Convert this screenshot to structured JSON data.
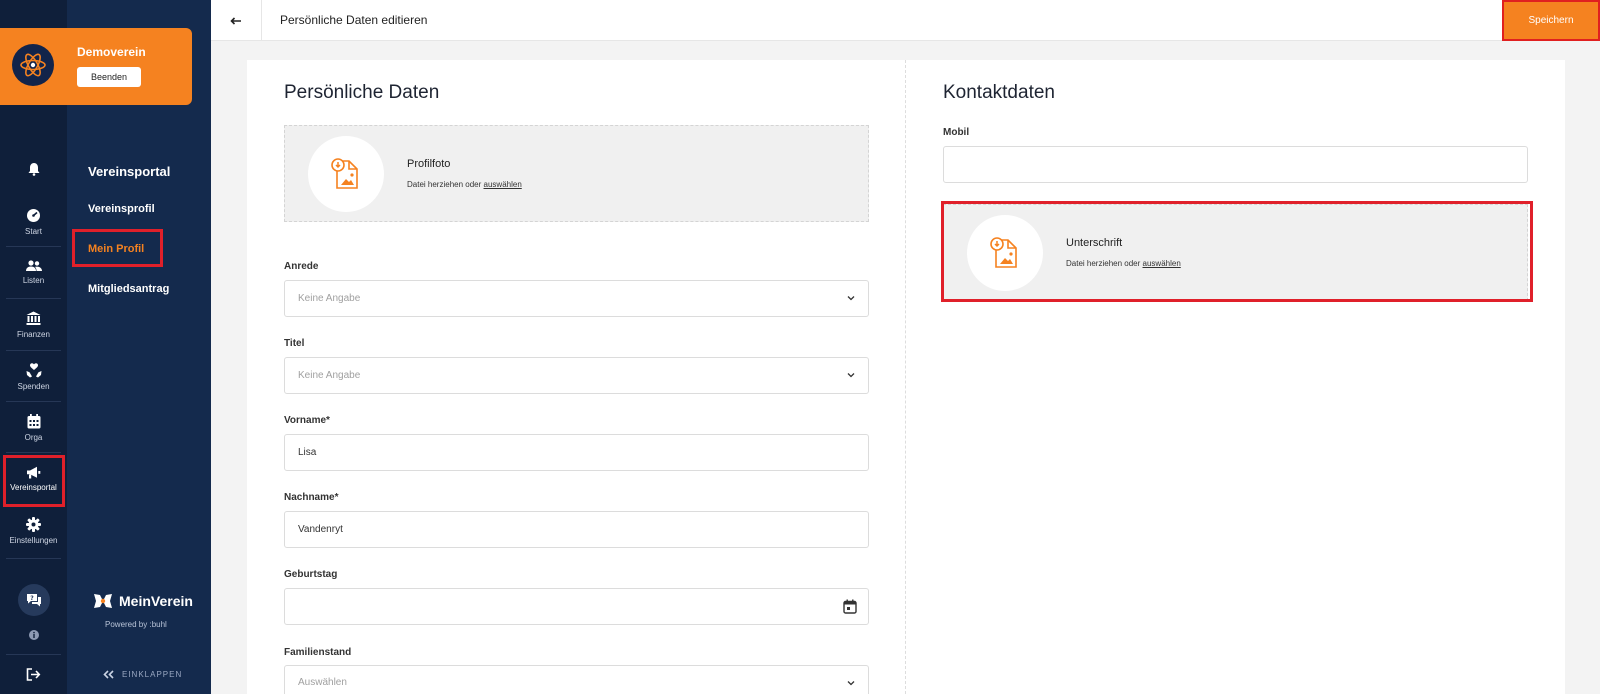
{
  "org": {
    "name": "Demoverein",
    "end_button": "Beenden"
  },
  "rail": {
    "items": [
      {
        "label": ""
      },
      {
        "label": "Start"
      },
      {
        "label": "Listen"
      },
      {
        "label": "Finanzen"
      },
      {
        "label": "Spenden"
      },
      {
        "label": "Orga"
      },
      {
        "label": "Vereinsportal"
      },
      {
        "label": "Einstellungen"
      }
    ]
  },
  "nav": {
    "title": "Vereinsportal",
    "items": [
      {
        "label": "Vereinsprofil"
      },
      {
        "label": "Mein Profil"
      },
      {
        "label": "Mitgliedsantrag"
      }
    ]
  },
  "brand": {
    "name": "MeinVerein",
    "powered": "Powered by :buhl",
    "collapse": "EINKLAPPEN"
  },
  "topbar": {
    "title": "Persönliche Daten editieren",
    "save": "Speichern"
  },
  "personal": {
    "title": "Persönliche Daten",
    "photo": {
      "title": "Profilfoto",
      "sub": "Datei herziehen oder",
      "link": "auswählen"
    },
    "anrede": {
      "label": "Anrede",
      "value": "Keine Angabe"
    },
    "titel": {
      "label": "Titel",
      "value": "Keine Angabe"
    },
    "vorname": {
      "label": "Vorname*",
      "value": "Lisa"
    },
    "nachname": {
      "label": "Nachname*",
      "value": "Vandenryt"
    },
    "geburtstag": {
      "label": "Geburtstag",
      "value": ""
    },
    "familienstand": {
      "label": "Familienstand",
      "value": "Auswählen"
    }
  },
  "contact": {
    "title": "Kontaktdaten",
    "mobil": {
      "label": "Mobil",
      "value": ""
    },
    "signature": {
      "title": "Unterschrift",
      "sub": "Datei herziehen oder",
      "link": "auswählen"
    }
  },
  "colors": {
    "accent": "#f58220",
    "sidebar_dark": "#0f1f3a",
    "sidebar": "#142a4d",
    "highlight": "#e0202a"
  }
}
